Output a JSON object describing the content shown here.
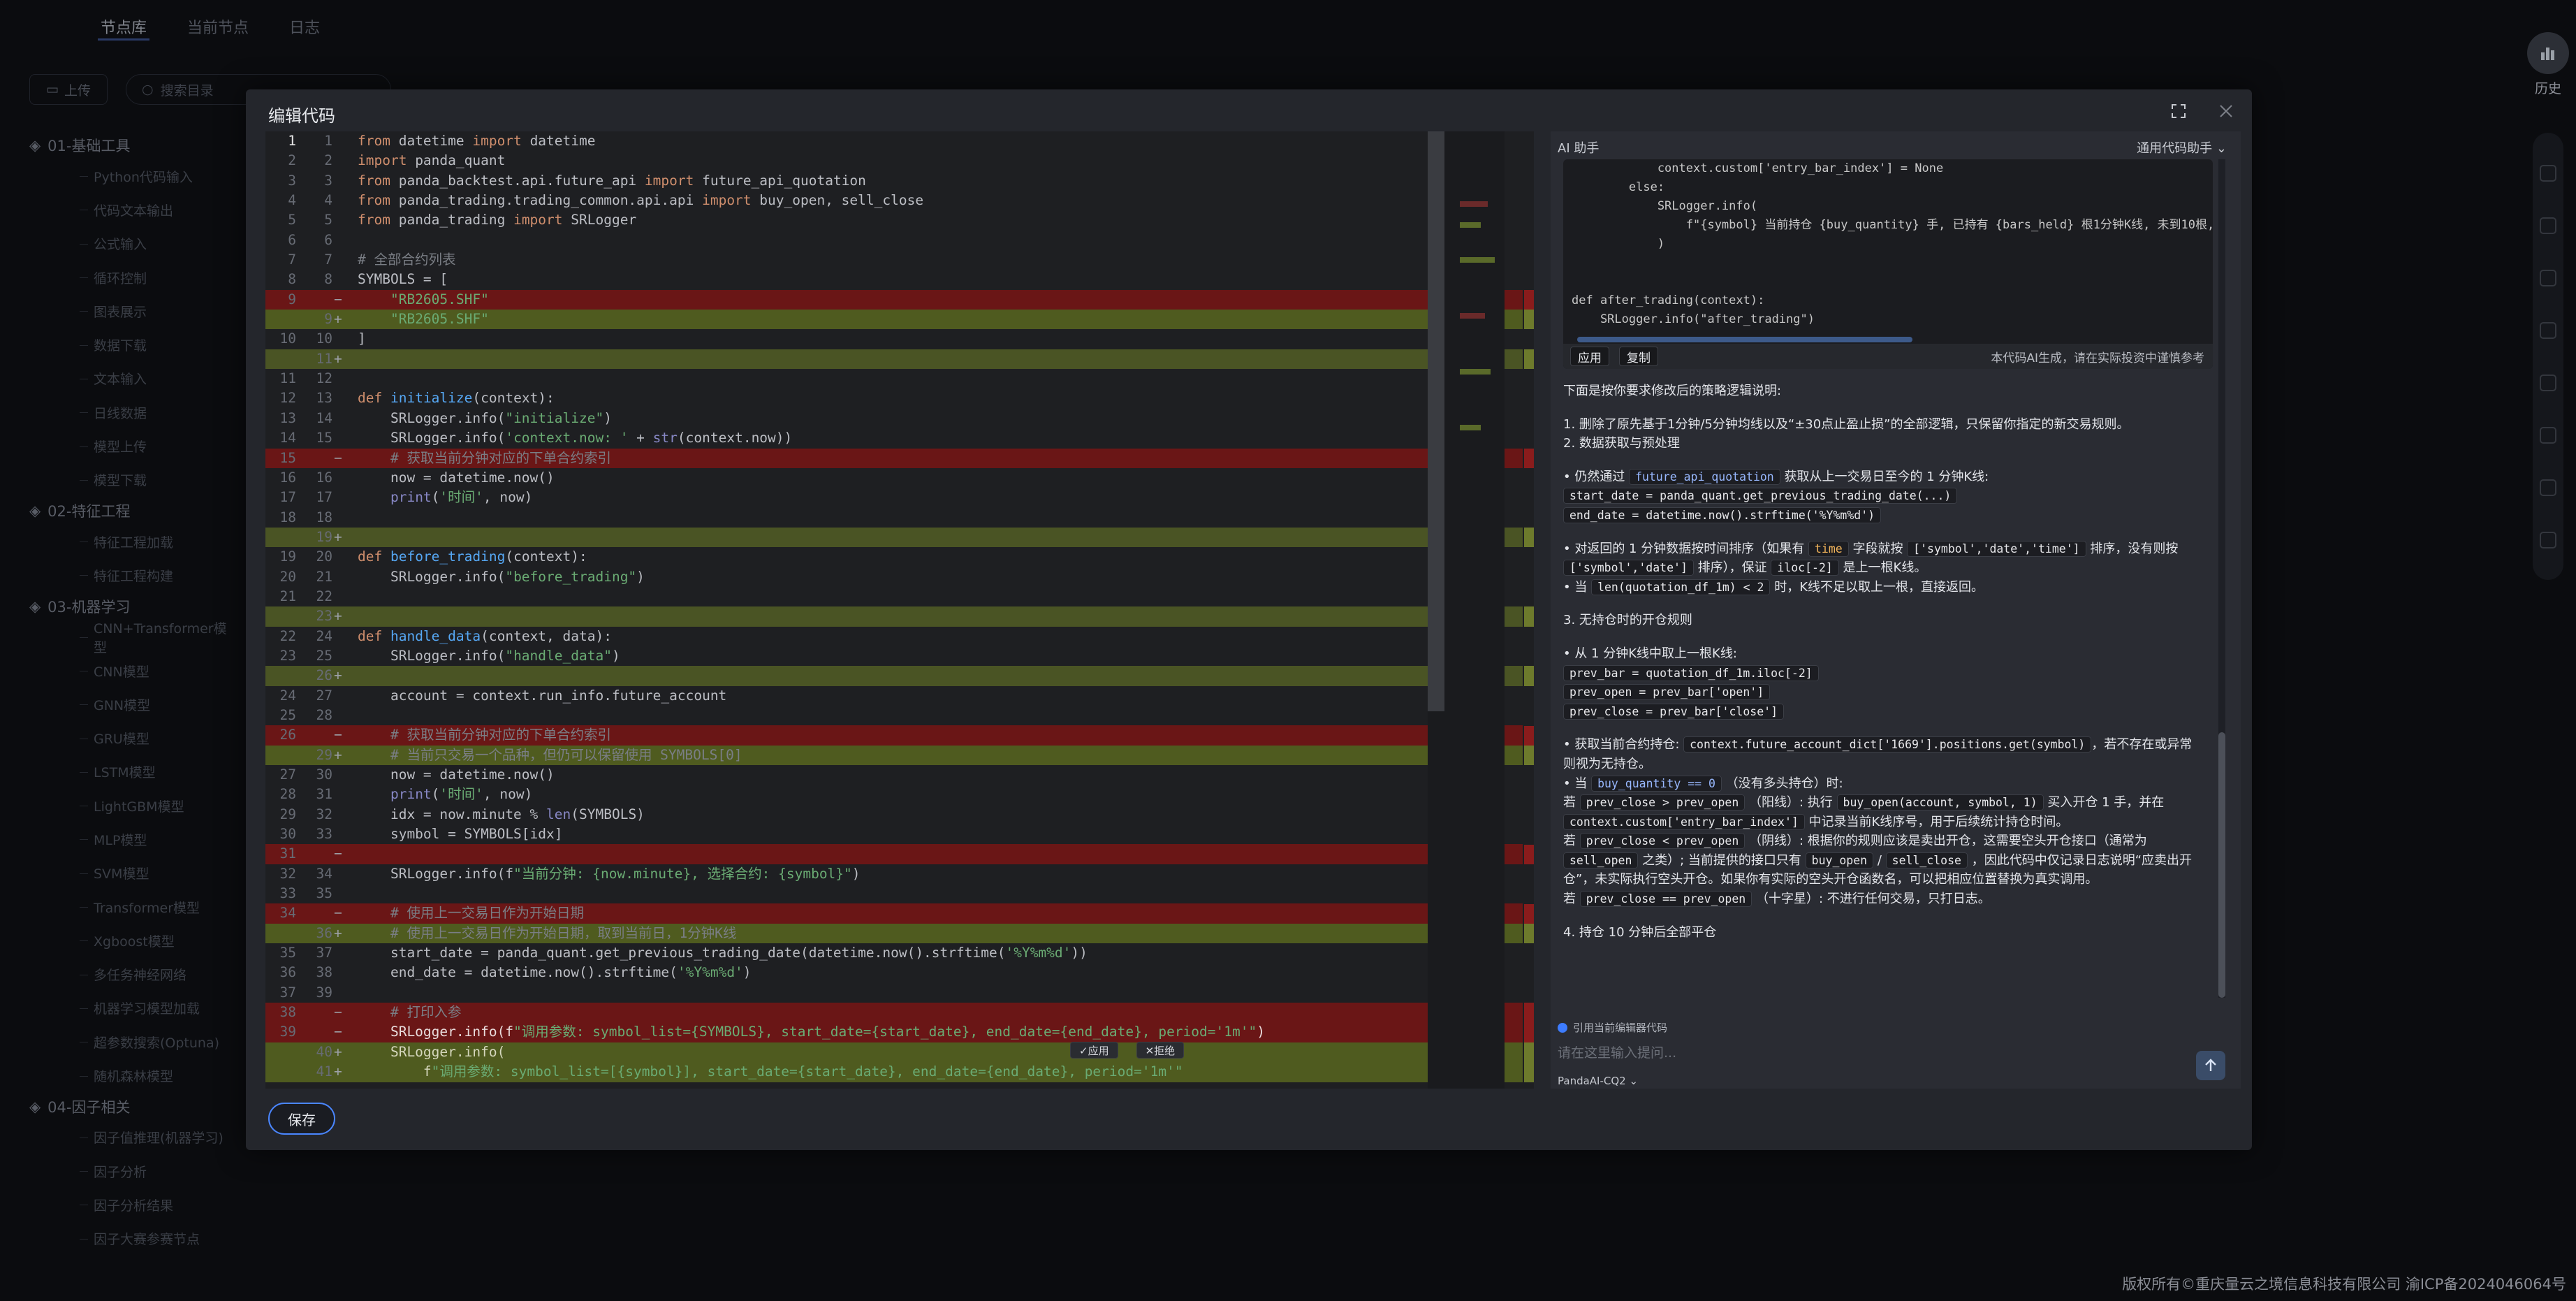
{
  "background": {
    "tabs": [
      "节点库",
      "当前节点",
      "日志"
    ],
    "upload_label": "上传",
    "search_placeholder": "搜索目录",
    "history_label": "历史",
    "groups": [
      {
        "label": "01-基础工具",
        "items": [
          "Python代码输入",
          "代码文本输出",
          "公式输入",
          "循环控制",
          "图表展示",
          "数据下载",
          "文本输入",
          "日线数据",
          "模型上传",
          "模型下载"
        ]
      },
      {
        "label": "02-特征工程",
        "items": [
          "特征工程加载",
          "特征工程构建"
        ]
      },
      {
        "label": "03-机器学习",
        "items": [
          "CNN+Transformer模型",
          "CNN模型",
          "GNN模型",
          "GRU模型",
          "LSTM模型",
          "LightGBM模型",
          "MLP模型",
          "SVM模型",
          "Transformer模型",
          "Xgboost模型",
          "多任务神经网络",
          "机器学习模型加载",
          "超参数搜索(Optuna)",
          "随机森林模型"
        ]
      },
      {
        "label": "04-因子相关",
        "items": [
          "因子值推理(机器学习)",
          "因子分析",
          "因子分析结果",
          "因子大赛参赛节点"
        ]
      }
    ],
    "footer": "版权所有©重庆量云之境信息科技有限公司 渝ICP备2024046064号"
  },
  "modal": {
    "title": "编辑代码",
    "save_label": "保存",
    "apply_label": "✓应用",
    "reject_label": "✕拒绝"
  },
  "code_lines": [
    {
      "l1": "1",
      "l2": "1",
      "m": "",
      "t": "from datetime import datetime",
      "c": ""
    },
    {
      "l1": "2",
      "l2": "2",
      "m": "",
      "t": "import panda_quant",
      "c": ""
    },
    {
      "l1": "3",
      "l2": "3",
      "m": "",
      "t": "from panda_backtest.api.future_api import future_api_quotation",
      "c": ""
    },
    {
      "l1": "4",
      "l2": "4",
      "m": "",
      "t": "from panda_trading.trading_common.api.api import buy_open, sell_close",
      "c": ""
    },
    {
      "l1": "5",
      "l2": "5",
      "m": "",
      "t": "from panda_trading import SRLogger",
      "c": ""
    },
    {
      "l1": "6",
      "l2": "6",
      "m": "",
      "t": "",
      "c": ""
    },
    {
      "l1": "7",
      "l2": "7",
      "m": "",
      "t": "# 全部合约列表",
      "c": ""
    },
    {
      "l1": "8",
      "l2": "8",
      "m": "",
      "t": "SYMBOLS = [",
      "c": ""
    },
    {
      "l1": "9",
      "l2": "",
      "m": "−",
      "t": "    \"RB2605.SHF\"",
      "c": "del"
    },
    {
      "l1": "",
      "l2": "9",
      "m": "+",
      "t": "    \"RB2605.SHF\"",
      "c": "add"
    },
    {
      "l1": "10",
      "l2": "10",
      "m": "",
      "t": "]",
      "c": ""
    },
    {
      "l1": "",
      "l2": "11",
      "m": "+",
      "t": "",
      "c": "emp"
    },
    {
      "l1": "11",
      "l2": "12",
      "m": "",
      "t": "",
      "c": ""
    },
    {
      "l1": "12",
      "l2": "13",
      "m": "",
      "t": "def initialize(context):",
      "c": ""
    },
    {
      "l1": "13",
      "l2": "14",
      "m": "",
      "t": "    SRLogger.info(\"initialize\")",
      "c": ""
    },
    {
      "l1": "14",
      "l2": "15",
      "m": "",
      "t": "    SRLogger.info('context.now: ' + str(context.now))",
      "c": ""
    },
    {
      "l1": "15",
      "l2": "",
      "m": "−",
      "t": "    # 获取当前分钟对应的下单合约索引",
      "c": "del"
    },
    {
      "l1": "16",
      "l2": "16",
      "m": "",
      "t": "    now = datetime.now()",
      "c": ""
    },
    {
      "l1": "17",
      "l2": "17",
      "m": "",
      "t": "    print('时间', now)",
      "c": ""
    },
    {
      "l1": "18",
      "l2": "18",
      "m": "",
      "t": "",
      "c": ""
    },
    {
      "l1": "",
      "l2": "19",
      "m": "+",
      "t": "",
      "c": "emp"
    },
    {
      "l1": "19",
      "l2": "20",
      "m": "",
      "t": "def before_trading(context):",
      "c": ""
    },
    {
      "l1": "20",
      "l2": "21",
      "m": "",
      "t": "    SRLogger.info(\"before_trading\")",
      "c": ""
    },
    {
      "l1": "21",
      "l2": "22",
      "m": "",
      "t": "",
      "c": ""
    },
    {
      "l1": "",
      "l2": "23",
      "m": "+",
      "t": "",
      "c": "emp"
    },
    {
      "l1": "22",
      "l2": "24",
      "m": "",
      "t": "def handle_data(context, data):",
      "c": ""
    },
    {
      "l1": "23",
      "l2": "25",
      "m": "",
      "t": "    SRLogger.info(\"handle_data\")",
      "c": ""
    },
    {
      "l1": "",
      "l2": "26",
      "m": "+",
      "t": "",
      "c": "emp"
    },
    {
      "l1": "24",
      "l2": "27",
      "m": "",
      "t": "    account = context.run_info.future_account",
      "c": ""
    },
    {
      "l1": "25",
      "l2": "28",
      "m": "",
      "t": "",
      "c": ""
    },
    {
      "l1": "26",
      "l2": "",
      "m": "−",
      "t": "    # 获取当前分钟对应的下单合约索引",
      "c": "del"
    },
    {
      "l1": "",
      "l2": "29",
      "m": "+",
      "t": "    # 当前只交易一个品种，但仍可以保留使用 SYMBOLS[0]",
      "c": "add"
    },
    {
      "l1": "27",
      "l2": "30",
      "m": "",
      "t": "    now = datetime.now()",
      "c": ""
    },
    {
      "l1": "28",
      "l2": "31",
      "m": "",
      "t": "    print('时间', now)",
      "c": ""
    },
    {
      "l1": "29",
      "l2": "32",
      "m": "",
      "t": "    idx = now.minute % len(SYMBOLS)",
      "c": ""
    },
    {
      "l1": "30",
      "l2": "33",
      "m": "",
      "t": "    symbol = SYMBOLS[idx]",
      "c": ""
    },
    {
      "l1": "31",
      "l2": "",
      "m": "−",
      "t": "",
      "c": "del"
    },
    {
      "l1": "32",
      "l2": "34",
      "m": "",
      "t": "    SRLogger.info(f\"当前分钟: {now.minute}, 选择合约: {symbol}\")",
      "c": ""
    },
    {
      "l1": "33",
      "l2": "35",
      "m": "",
      "t": "",
      "c": ""
    },
    {
      "l1": "34",
      "l2": "",
      "m": "−",
      "t": "    # 使用上一交易日作为开始日期",
      "c": "del"
    },
    {
      "l1": "",
      "l2": "36",
      "m": "+",
      "t": "    # 使用上一交易日作为开始日期，取到当前日，1分钟K线",
      "c": "add"
    },
    {
      "l1": "35",
      "l2": "37",
      "m": "",
      "t": "    start_date = panda_quant.get_previous_trading_date(datetime.now().strftime('%Y%m%d'))",
      "c": ""
    },
    {
      "l1": "36",
      "l2": "38",
      "m": "",
      "t": "    end_date = datetime.now().strftime('%Y%m%d')",
      "c": ""
    },
    {
      "l1": "37",
      "l2": "39",
      "m": "",
      "t": "",
      "c": ""
    },
    {
      "l1": "38",
      "l2": "",
      "m": "−",
      "t": "    # 打印入参",
      "c": "del"
    },
    {
      "l1": "39",
      "l2": "",
      "m": "−",
      "t": "    SRLogger.info(f\"调用参数: symbol_list={SYMBOLS}, start_date={start_date}, end_date={end_date}, period='1m'\")",
      "c": "del"
    },
    {
      "l1": "",
      "l2": "40",
      "m": "+",
      "t": "    SRLogger.info(",
      "c": "add"
    },
    {
      "l1": "",
      "l2": "41",
      "m": "+",
      "t": "        f\"调用参数: symbol_list=[{symbol}], start_date={start_date}, end_date={end_date}, period='1m'\"",
      "c": "add"
    }
  ],
  "ai": {
    "header": "AI 助手",
    "mode_dropdown": "通用代码助手",
    "code_snippet": [
      "            context.custom['entry_bar_index'] = None",
      "        else:",
      "            SRLogger.info(",
      "                f\"{symbol} 当前持仓 {buy_quantity} 手, 已持有 {bars_held} 根1分钟K线, 未到10根,",
      "            )",
      "",
      "",
      "def after_trading(context):",
      "    SRLogger.info(\"after_trading\")"
    ],
    "apply_label": "应用",
    "copy_label": "复制",
    "disclaimer": "本代码AI生成，请在实际投资中谨慎参考",
    "explain": [
      {
        "type": "p",
        "parts": [
          {
            "t": "下面是按你要求修改后的策略逻辑说明:"
          }
        ]
      },
      {
        "type": "gap"
      },
      {
        "type": "p",
        "parts": [
          {
            "t": "1. 删除了原先基于1分钟/5分钟均线以及“±30点止盈止损”的全部逻辑，只保留你指定的新交易规则。"
          }
        ]
      },
      {
        "type": "p",
        "parts": [
          {
            "t": "2. 数据获取与预处理"
          }
        ]
      },
      {
        "type": "gap"
      },
      {
        "type": "p",
        "parts": [
          {
            "t": "•  仍然通过 "
          },
          {
            "c": "future_api_quotation",
            "k": "b"
          },
          {
            "t": " 获取从上一交易日至今的 1 分钟K线:"
          }
        ]
      },
      {
        "type": "p",
        "parts": [
          {
            "c": "start_date = panda_quant.get_previous_trading_date(...)"
          }
        ]
      },
      {
        "type": "p",
        "parts": [
          {
            "c": "end_date = datetime.now().strftime('%Y%m%d')"
          }
        ]
      },
      {
        "type": "gap"
      },
      {
        "type": "p",
        "parts": [
          {
            "t": "•  对返回的 1 分钟数据按时间排序（如果有 "
          },
          {
            "c": "time",
            "k": "y"
          },
          {
            "t": " 字段就按 "
          },
          {
            "c": "['symbol','date','time']"
          },
          {
            "t": " 排序，没有则按"
          }
        ]
      },
      {
        "type": "p",
        "parts": [
          {
            "c": "['symbol','date']"
          },
          {
            "t": " 排序），保证 "
          },
          {
            "c": "iloc[-2]"
          },
          {
            "t": " 是上一根K线。"
          }
        ]
      },
      {
        "type": "p",
        "parts": [
          {
            "t": "•  当 "
          },
          {
            "c": "len(quotation_df_1m) < 2"
          },
          {
            "t": " 时，K线不足以取上一根，直接返回。"
          }
        ]
      },
      {
        "type": "gap"
      },
      {
        "type": "p",
        "parts": [
          {
            "t": "3. 无持仓时的开仓规则"
          }
        ]
      },
      {
        "type": "gap"
      },
      {
        "type": "p",
        "parts": [
          {
            "t": "•  从 1 分钟K线中取上一根K线:"
          }
        ]
      },
      {
        "type": "p",
        "parts": [
          {
            "c": "prev_bar = quotation_df_1m.iloc[-2]"
          }
        ]
      },
      {
        "type": "p",
        "parts": [
          {
            "c": "prev_open = prev_bar['open']"
          }
        ]
      },
      {
        "type": "p",
        "parts": [
          {
            "c": "prev_close = prev_bar['close']"
          }
        ]
      },
      {
        "type": "gap"
      },
      {
        "type": "p",
        "parts": [
          {
            "t": "•  获取当前合约持仓: "
          },
          {
            "c": "context.future_account_dict['1669'].positions.get(symbol)"
          },
          {
            "t": "，若不存在或异常"
          }
        ]
      },
      {
        "type": "p",
        "parts": [
          {
            "t": "则视为无持仓。"
          }
        ]
      },
      {
        "type": "p",
        "parts": [
          {
            "t": "•  当 "
          },
          {
            "c": "buy_quantity == 0",
            "k": "b"
          },
          {
            "t": " （没有多头持仓）时:"
          }
        ]
      },
      {
        "type": "p",
        "parts": [
          {
            "t": "若 "
          },
          {
            "c": "prev_close > prev_open"
          },
          {
            "t": " （阳线）: 执行 "
          },
          {
            "c": "buy_open(account, symbol, 1)"
          },
          {
            "t": " 买入开仓 1 手，并在"
          }
        ]
      },
      {
        "type": "p",
        "parts": [
          {
            "c": "context.custom['entry_bar_index']"
          },
          {
            "t": " 中记录当前K线序号，用于后续统计持仓时间。"
          }
        ]
      },
      {
        "type": "p",
        "parts": [
          {
            "t": "若 "
          },
          {
            "c": "prev_close < prev_open"
          },
          {
            "t": " （阴线）: 根据你的规则应该是卖出开仓，这需要空头开仓接口（通常为"
          }
        ]
      },
      {
        "type": "p",
        "parts": [
          {
            "c": "sell_open"
          },
          {
            "t": " 之类）; 当前提供的接口只有 "
          },
          {
            "c": "buy_open"
          },
          {
            "t": " / "
          },
          {
            "c": "sell_close"
          },
          {
            "t": " ，因此代码中仅记录日志说明“应卖出开"
          }
        ]
      },
      {
        "type": "p",
        "parts": [
          {
            "t": "仓”，未实际执行空头开仓。如果你有实际的空头开仓函数名，可以把相应位置替换为真实调用。"
          }
        ]
      },
      {
        "type": "p",
        "parts": [
          {
            "t": "若 "
          },
          {
            "c": "prev_close == prev_open"
          },
          {
            "t": " （十字星）: 不进行任何交易，只打日志。"
          }
        ]
      },
      {
        "type": "gap"
      },
      {
        "type": "p",
        "parts": [
          {
            "t": "4. 持仓 10 分钟后全部平仓"
          }
        ]
      }
    ],
    "checkbox_label": "引用当前编辑器代码",
    "input_placeholder": "请在这里输入提问...",
    "model_label": "PandaAI-CQ2"
  },
  "colors": {
    "accent": "#3d7cff",
    "diff_deleted": "#6a1616",
    "diff_added": "#4f5b1f"
  }
}
